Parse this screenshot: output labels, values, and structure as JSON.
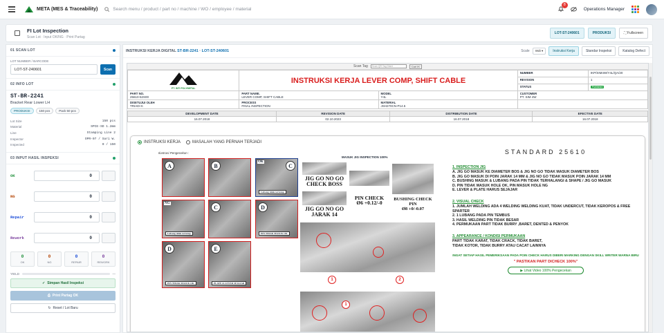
{
  "app": {
    "name": "META (MES & Traceability)",
    "search_placeholder": "Search menu / product / part no / machine / WO / employee / material",
    "notif_count": "8",
    "user": "Operations Manager"
  },
  "page": {
    "title": "FI Lot Inspection",
    "subtitle": "Scan Lot · Input OK/NG · Print Partag",
    "lot_chip": "LOT-ST-240601",
    "produksi_chip": "PRODUKSI",
    "fullscreen": "Fullscreen"
  },
  "scan_lot": {
    "header": "01 SCAN LOT",
    "label": "LOT NUMBER / BARCODE",
    "value": "LOT-ST-240601",
    "button": "Scan"
  },
  "info_lot": {
    "header": "02 INFO LOT",
    "part_no": "ST-BR-2241",
    "part_name": "Bracket Rear Lower LH",
    "pills": [
      "PRODUKSI",
      "150 pcs",
      "Pack 50 pcs"
    ],
    "rows": [
      {
        "k": "Lot Size",
        "v": "150 pcs"
      },
      {
        "k": "Material",
        "v": "SPCE-SD 1.2mm"
      },
      {
        "k": "Line",
        "v": "Stamping Line 2"
      },
      {
        "k": "Inspector",
        "v": "OPR-07 / Sari W."
      },
      {
        "k": "Inspected",
        "v": "0 / 150"
      }
    ]
  },
  "input": {
    "header": "03 INPUT HASIL INSPEKSI",
    "rows": [
      {
        "name": "OK",
        "value": "0",
        "color": "#1f8f3a"
      },
      {
        "name": "NG",
        "value": "0",
        "color": "#b54708"
      },
      {
        "name": "Repair",
        "value": "0",
        "color": "#1d4ed8"
      },
      {
        "name": "Rework",
        "value": "0",
        "color": "#7a3e9d"
      }
    ],
    "counts": [
      {
        "v": "0",
        "l": "OK",
        "color": "#1f8f3a"
      },
      {
        "v": "0",
        "l": "NG",
        "color": "#b54708"
      },
      {
        "v": "0",
        "l": "REPAIR",
        "color": "#1d4ed8"
      },
      {
        "v": "0",
        "l": "REWORK",
        "color": "#7a3e9d"
      }
    ],
    "yield_label": "YIELD",
    "yield_value": "—",
    "yield_fraction": 0.0,
    "btn_save": "Simpan Hasil Inspeksi",
    "btn_print": "Print Partag OK",
    "btn_reset": "Reset / Lot Baru"
  },
  "ik": {
    "title_prefix": "INSTRUKSI KERJA DIGITAL",
    "part": "ST-BR-2241",
    "lot": "LOT-ST-240601",
    "scale_label": "Scale",
    "scale_value": "Wdt",
    "tabs": [
      "Instruksi Kerja",
      "Standar Inspeksi",
      "Katalog Defect"
    ]
  },
  "doc": {
    "scan_tag": "Scan Tag",
    "scan_ph": "Scan QR Tag Disini",
    "scan_btn": "Cari IK",
    "company": "PT. INTI POLYMETAL",
    "title": "INSTRUKSI KERJA LEVER COMP, SHIFT CABLE",
    "number_l": "NUMBER",
    "number_v": "IKP/SIM4W/Y4L/QA/20",
    "revision_l": "REVISION",
    "revision_v": "1",
    "status_l": "STATUS",
    "status_v": "Published",
    "partno_l": "PART NO.",
    "partno_v": "25610-52S00",
    "partname_l": "PART NAME.",
    "partname_v": "LEVER COMP, SHIFT CABLE",
    "model_l": "MODEL",
    "model_v": "Y4L",
    "customer_l": "CUSTOMER",
    "customer_v": "PT. SIM 4W",
    "disetujui_l": "DISETUJUI OLEH",
    "disetujui_v": "TRIADI K",
    "process_l": "PROCESS",
    "process_v": "FINAL INSPECTION",
    "material_l": "MATERIAL",
    "material_v": "JSH270CN-P14.5",
    "dev_l": "DEVELOPMENT DATE",
    "dev_v": "16.07.2018",
    "rev_l": "REVISION DATE",
    "rev_v": "02.10.2023",
    "dist_l": "DISTRIBUTION DATE",
    "dist_v": "16.07.2018",
    "eff_l": "EFECTIVE DATE",
    "eff_v": "16.07.2018",
    "tab1": "INSTRUKSI KERJA",
    "tab2": "MASALAH YANG PERNAH TERJADI",
    "ilustrasi": "Ilustrasi Pengecekan :",
    "masuk_jig": "MASUK JIG INSPECTION 100%",
    "cap_a_note": "Lubang tidak tertutup",
    "cap_ok": "OK",
    "cap_c_note": "Lubang tidak tertutup",
    "cap_ng": "NG",
    "cap_d1": "PIN TIDAK MASUK OK",
    "cap_d2": "PIN TIDAK MASUK OK",
    "cap_e": "PLATE & LEVER SEJAJAR",
    "jig1": "JIG GO NO GO CHECK BOSS",
    "jig2": "JIG GO NO GO JARAK 14",
    "pin_check_1": "PIN CHECK",
    "pin_check_2": "Ø6 +0.12/-0",
    "bushing_1": "BUSHING CHECK PIN",
    "bushing_2": "Ø8 +0/-0.07",
    "circle1": "1",
    "circle2": "2",
    "circle3": "1",
    "standard": "STANDARD 25610",
    "s1_h": "1. INSPECTION JIG",
    "s1": [
      "A. JIG GO MASUK KE DIAMETER BOS & JIG NO GO TIDAK MASUK DIAMETER BOS",
      "B. JIG GO MASUK DI POIN JARAK 14 MM & JIG NO GO TIDAK MASUK POIN JARAK 14 MM",
      "C. BUSHING MASUK & LUBANG PADA PIN TIDAK TERHALANGI & SHAPE / JIG GO MASUK",
      "D. PIN TIDAK MASUK HOLE OK, PIN MASUK HOLE NG",
      "E. LEVER & PLATE HARUS SEJAJAR"
    ],
    "s2_h": "2. VISUAL CHECK",
    "s2": [
      "1. JUMLAH WELDING ADA 4 WELDING WELDING KUAT, TIDAK UNDERCUT, TIDAK KEROPOS & FREE SPARTER",
      "2. 1 LUBANG PADA PIN TEMBUS",
      "3. HASIL WELDING PIN TIDAK BESAR",
      "4. PERMUKAAN PART TIDAK BURRY ,BARET, DENTED & PENYOK"
    ],
    "s3_h": "3. APPEARANCE / KONDISI PERMUKAAN",
    "s3": [
      "PART TIDAK KARAT, TIDAK CRACK, TIDAK BARET,",
      "TIDAK KOTOR, TIDAK BURRY ATAU CACAT LAINNYA"
    ],
    "note": "INGAT SETIAP HASIL PEMERIKSAAN PADA POIN CHECK HARUS DIBERI MARKING DENGAN SKILL WRITER WARNA BIRU",
    "pastikan": "\" PASTIKAN PART DICHECK 100%\"",
    "video": "Lihat Video 100% Pengecekan"
  },
  "colors": {
    "accent": "#0d6fb0",
    "success": "#22a06b",
    "danger": "#d91c1c"
  }
}
